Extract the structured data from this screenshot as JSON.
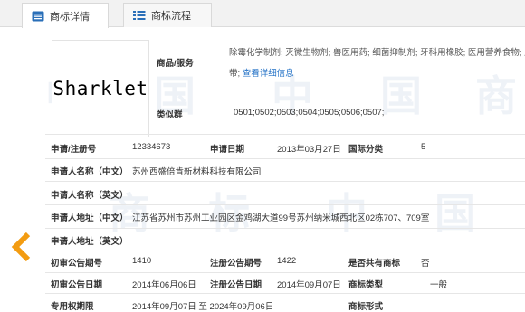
{
  "tabs": [
    {
      "label": "商标详情",
      "active": true,
      "icon": "document-list-icon"
    },
    {
      "label": "商标流程",
      "active": false,
      "icon": "flow-list-icon"
    }
  ],
  "watermark": {
    "chars": [
      "中",
      "国",
      "商",
      "标"
    ]
  },
  "trademark": {
    "logo_text": "Sharklet",
    "goods_label": "商品/服务",
    "goods_line1": "除霉化学制剂; 灭微生物剂; 兽医用药; 细菌抑制剂; 牙科用橡胶; 医用营养食物; 月经",
    "goods_line2": "带;",
    "goods_link": "查看详细信息",
    "similar_label": "类似群",
    "similar_value": "0501;0502;0503;0504;0505;0506;0507;"
  },
  "fields": {
    "reg_no_label": "申请/注册号",
    "reg_no_value": "12334673",
    "app_date_label": "申请日期",
    "app_date_value": "2013年03月27日",
    "intl_class_label": "国际分类",
    "intl_class_value": "5",
    "applicant_cn_label": "申请人名称（中文）",
    "applicant_cn_value": "苏州西盛倍肯新材料科技有限公司",
    "applicant_en_label": "申请人名称（英文）",
    "address_cn_label": "申请人地址（中文）",
    "address_cn_value": "江苏省苏州市苏州工业园区金鸡湖大道99号苏州纳米城西北区02栋707、709室",
    "address_en_label": "申请人地址（英文）",
    "prelim_issue_label": "初审公告期号",
    "prelim_issue_value": "1410",
    "reg_issue_label": "注册公告期号",
    "reg_issue_value": "1422",
    "shared_label": "是否共有商标",
    "shared_value": "否",
    "prelim_date_label": "初审公告日期",
    "prelim_date_value": "2014年06月06日",
    "reg_date_label": "注册公告日期",
    "reg_date_value": "2014年09月07日",
    "type_label": "商标类型",
    "type_value": "一般",
    "period_label": "专用权期限",
    "period_value": "2014年09月07日 至 2024年09月06日",
    "form_label": "商标形式"
  },
  "nav": {
    "prev_icon": "chevron-left-icon"
  },
  "colors": {
    "accent_orange": "#f39c12",
    "link_blue": "#1f6fc5",
    "tab_icon_blue": "#2a6fb8"
  }
}
